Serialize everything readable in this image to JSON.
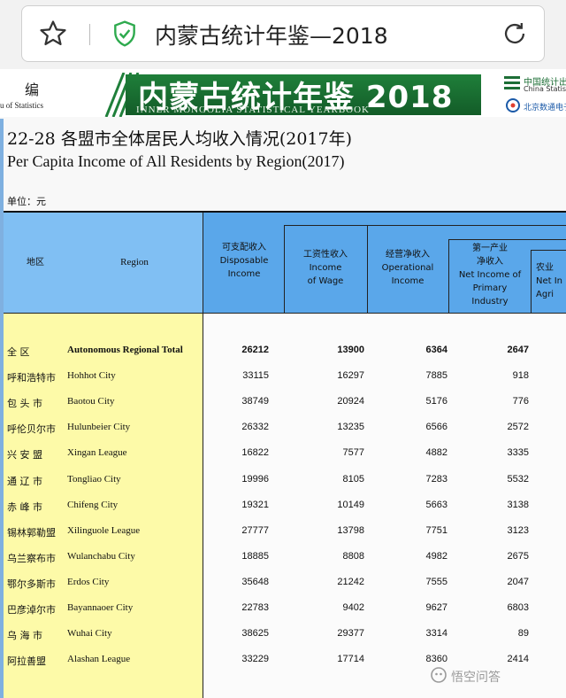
{
  "browser": {
    "url_title": "内蒙古统计年鉴—2018",
    "icons": {
      "favorite": "star-icon",
      "security": "shield-check-icon",
      "reload": "reload-icon"
    },
    "colors": {
      "security": "#2eaa4e"
    }
  },
  "banner": {
    "left_char": "编",
    "left_en": "u of Statistics",
    "title": "内蒙古统计年鉴 2018",
    "subtitle": "INNER MONGOLIA STATISTICAL YEARBOOK",
    "right_cn": "中国统计出",
    "right_en": "China Statistics",
    "right_cn2": "北京数通电子",
    "colors": {
      "green": "#1f7f3a"
    }
  },
  "document": {
    "title_cn": "22-28 各盟市全体居民人均收入情况(2017年)",
    "title_en": "Per Capita Income of All Residents by Region(2017)",
    "unit": "单位：元"
  },
  "table": {
    "headers": {
      "region_cn": "地区",
      "region_en": "Region",
      "disposable": "可支配收入\nDisposable\nIncome",
      "wage": "工资性收入\nIncome\nof Wage",
      "operational": "经营净收入\nOperational\nIncome",
      "primary": "第一产业\n净收入\nNet Income of\nPrimary\nIndustry",
      "agri": "农业\nNet In\nAgri"
    },
    "rows": [
      {
        "cn": "全 区",
        "en": "Autonomous Regional Total",
        "disposable": "26212",
        "wage": "13900",
        "operational": "6364",
        "primary": "2647",
        "bold": true
      },
      {
        "cn": "呼和浩特市",
        "en": "Hohhot City",
        "disposable": "33115",
        "wage": "16297",
        "operational": "7885",
        "primary": "918"
      },
      {
        "cn": "包 头 市",
        "en": "Baotou City",
        "disposable": "38749",
        "wage": "20924",
        "operational": "5176",
        "primary": "776"
      },
      {
        "cn": "呼伦贝尔市",
        "en": "Hulunbeier City",
        "disposable": "26332",
        "wage": "13235",
        "operational": "6566",
        "primary": "2572"
      },
      {
        "cn": "兴 安 盟",
        "en": "Xingan League",
        "disposable": "16822",
        "wage": "7577",
        "operational": "4882",
        "primary": "3335"
      },
      {
        "cn": "通 辽 市",
        "en": "Tongliao City",
        "disposable": "19996",
        "wage": "8105",
        "operational": "7283",
        "primary": "5532"
      },
      {
        "cn": "赤 峰 市",
        "en": "Chifeng City",
        "disposable": "19321",
        "wage": "10149",
        "operational": "5663",
        "primary": "3138"
      },
      {
        "cn": "锡林郭勒盟",
        "en": "Xilinguole League",
        "disposable": "27777",
        "wage": "13798",
        "operational": "7751",
        "primary": "3123"
      },
      {
        "cn": "乌兰察布市",
        "en": "Wulanchabu City",
        "disposable": "18885",
        "wage": "8808",
        "operational": "4982",
        "primary": "2675"
      },
      {
        "cn": "鄂尔多斯市",
        "en": "Erdos City",
        "disposable": "35648",
        "wage": "21242",
        "operational": "7555",
        "primary": "2047"
      },
      {
        "cn": "巴彦淖尔市",
        "en": "Bayannaoer City",
        "disposable": "22783",
        "wage": "9402",
        "operational": "9627",
        "primary": "6803"
      },
      {
        "cn": "乌 海 市",
        "en": "Wuhai City",
        "disposable": "38625",
        "wage": "29377",
        "operational": "3314",
        "primary": "89"
      },
      {
        "cn": "阿拉善盟",
        "en": "Alashan League",
        "disposable": "33229",
        "wage": "17714",
        "operational": "8360",
        "primary": "2414"
      }
    ],
    "colors": {
      "header": "#5aa7ea",
      "region_col": "#fdfaa8"
    }
  },
  "watermark": "悟空问答"
}
